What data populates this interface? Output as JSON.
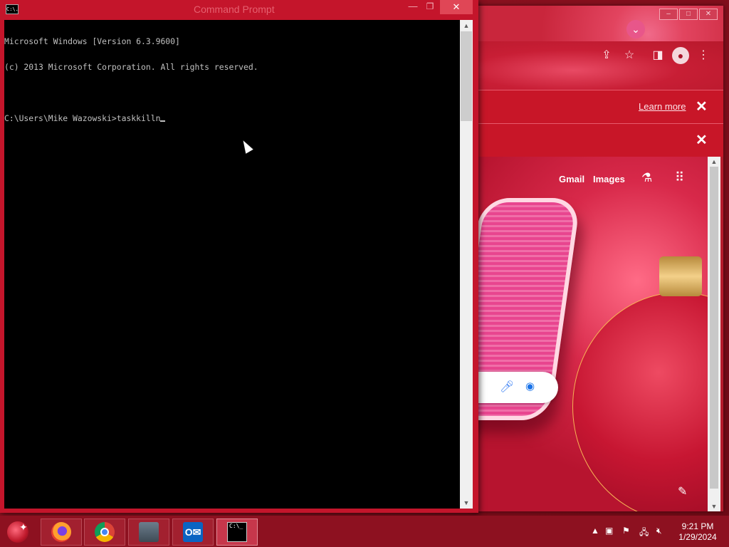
{
  "cmd": {
    "title": "Command Prompt",
    "icon_label": "C:\\.",
    "controls": {
      "minimize": "—",
      "maximize": "❐",
      "close": "✕"
    },
    "lines": [
      "Microsoft Windows [Version 6.3.9600]",
      "(c) 2013 Microsoft Corporation. All rights reserved.",
      "",
      "C:\\Users\\Mike Wazowski>taskkilln"
    ]
  },
  "chrome": {
    "controls": {
      "minimize": "–",
      "maximize": "□",
      "close": "✕"
    },
    "tab_search_icon": "chevron-down-icon",
    "toolbar_icons": [
      "share-icon",
      "bookmark-star-icon",
      "side-panel-icon",
      "profile-icon",
      "more-menu-icon"
    ],
    "infobar_learn_more": "Learn more",
    "infobar_close": "✕",
    "links": {
      "gmail": "Gmail",
      "images": "Images"
    },
    "icons": [
      "labs-flask-icon",
      "apps-grid-icon",
      "mic-icon",
      "camera-lens-icon",
      "edit-pencil-icon"
    ]
  },
  "taskbar": {
    "apps": [
      {
        "name": "Firefox",
        "icon": "firefox-icon"
      },
      {
        "name": "Google Chrome",
        "icon": "chrome-icon"
      },
      {
        "name": "Remote Desktop",
        "icon": "remote-desktop-icon"
      },
      {
        "name": "Outlook",
        "icon": "outlook-icon",
        "glyph": "O✉"
      },
      {
        "name": "Command Prompt",
        "icon": "cmd-icon",
        "glyph": "C:\\_",
        "active": true
      }
    ],
    "tray_icons": [
      "show-hidden-icons-arrow",
      "action-center-icon",
      "flag-icon",
      "network-icon",
      "volume-muted-icon"
    ],
    "time": "9:21 PM",
    "date": "1/29/2024"
  },
  "colors": {
    "accent": "#c4152b",
    "taskbar": "#8d1120",
    "console_bg": "#000000",
    "console_fg": "#c0c0c0"
  }
}
